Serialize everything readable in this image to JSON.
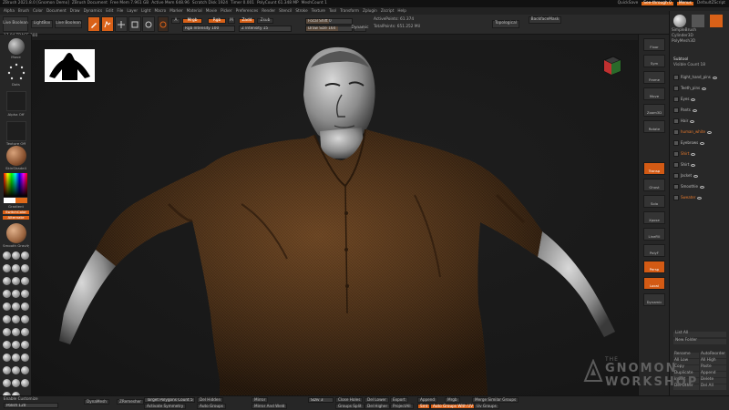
{
  "titlebar": {
    "items": [
      "ZBrush 2021.8.0 [Gnomon Demo]",
      "ZBrush Document",
      "Free Mem 7.961 GB",
      "Active Mem 648.96",
      "Scratch Disk 1924",
      "Timer 0.001",
      "PolyCount 61.348 MP",
      "MeshCount 1"
    ],
    "quicksave": "QuickSave",
    "seethrough": "See-through 0",
    "menus": "Menus",
    "defaultzscript": "DefaultZScript"
  },
  "menubar": {
    "items": [
      "Alpha",
      "Brush",
      "Color",
      "Document",
      "Draw",
      "Dynamics",
      "Edit",
      "File",
      "Layer",
      "Light",
      "Macro",
      "Marker",
      "Material",
      "Movie",
      "Picker",
      "Preferences",
      "Render",
      "Stencil",
      "Stroke",
      "Texture",
      "Tool",
      "Transform",
      "Zplugin",
      "Zscript",
      "Help"
    ]
  },
  "topshelf": {
    "lightbox": "LightBox",
    "live_boolean": "Live Boolean",
    "edit": "Edit",
    "draw": "Draw",
    "move": "Move",
    "scale": "Scale",
    "rotate": "Rotate",
    "mrgb": "Mrgb",
    "rgb": "Rgb",
    "m": "M",
    "zadd": "Zadd",
    "zsub": "Zsub",
    "rgb_intensity": "Rgb Intensity 100",
    "z_intensity": "Z Intensity 15",
    "focal_shift": "Focal Shift 0",
    "draw_size": "Draw Size 164",
    "dynamic": "Dynamic",
    "active_points": "ActivePoints: 61.374",
    "total_points": "TotalPoints: 651.252 Mil",
    "topological": "Topological",
    "backface_mask": "BackfaceMask",
    "subtitle": "17.04.TRACE 300"
  },
  "leftpanel": {
    "brush_label": "Move",
    "stroke_label": "Dots",
    "alpha_label": "Alpha Off",
    "texture_label": "Texture Off",
    "material_label": "SkinShade4",
    "gradient_label": "Gradient",
    "switch_color": "SwitchColor",
    "alternate": "Alternate",
    "smooth_label": "Smooth Gravity",
    "brushes": [
      "Standard",
      "Move",
      "ClayBuildup",
      "DamStandard",
      "TrimDynamic",
      "hPolish",
      "Pinch",
      "Inflate",
      "Smooth",
      "Nudge",
      "Snakehook",
      "Crease",
      "Slash3"
    ],
    "main_color": "#e06a1a",
    "secondary_color": "#ffffff"
  },
  "rightstrip": {
    "items": [
      "Floor",
      "Sym",
      "Frame",
      "Move",
      "Zoom3D",
      "Rotate",
      "Transp",
      "Ghost",
      "Solo",
      "Xpose",
      "LineFill",
      "PolyF",
      "Persp",
      "Local",
      "Dynamic"
    ]
  },
  "rightpanel": {
    "header": "Subtool",
    "visible_count": "Visible Count 18",
    "spotlight": "Spotlight",
    "tool_names": [
      "SimpleBrush",
      "Cylinder3D",
      "PolyMesh3D"
    ],
    "subtools": [
      "Right_hand_pins",
      "Teeth_pins",
      "Eyes",
      "Pants",
      "Hair",
      "human_white",
      "Eyebrows",
      "Shirt",
      "Shirt",
      "Jacket",
      "Smoothie",
      "Sweater"
    ],
    "list_all": "List All",
    "new_folder": "New Folder",
    "rename": "Rename",
    "autoreorder": "AutoReorder",
    "all_low": "All Low",
    "all_high": "All High",
    "copy": "Copy",
    "paste": "Paste",
    "duplicate": "Duplicate",
    "append": "Append",
    "insert": "Insert",
    "delete": "Delete",
    "del_other": "Del Other",
    "del_all": "Del All",
    "split": "Split",
    "merge": "Merge"
  },
  "bottombar": {
    "enable_customize": "Enable Customize",
    "polish": "Polish 120",
    "dynamesh": "DynaMesh",
    "zremesher": "ZRemesher",
    "target_polycount": "Target Polygons Count 5",
    "activate_symmetry": "Activate Symmetry",
    "del_hidden": "Del Hidden",
    "auto_groups": "Auto Groups",
    "close_holes": "Close Holes",
    "del_lower": "Del Lower",
    "del_higher": "Del Higher",
    "mirror": "Mirror",
    "mirror_and_weld": "Mirror And Weld",
    "groups_split": "Groups Split",
    "smt": "Smt",
    "export": "Export",
    "append": "Append",
    "projectall": "ProjectAll",
    "merge_similar": "Merge Similar Groups",
    "autogroups_uv": "Auto Groups With UV",
    "uv_groups": "Uv Groups",
    "sdiv": "SDiv 3",
    "mrgb": "Mrgb"
  },
  "watermark": {
    "the": "THE",
    "gnomon": "GNOMON",
    "workshop": "WORKSHOP"
  }
}
